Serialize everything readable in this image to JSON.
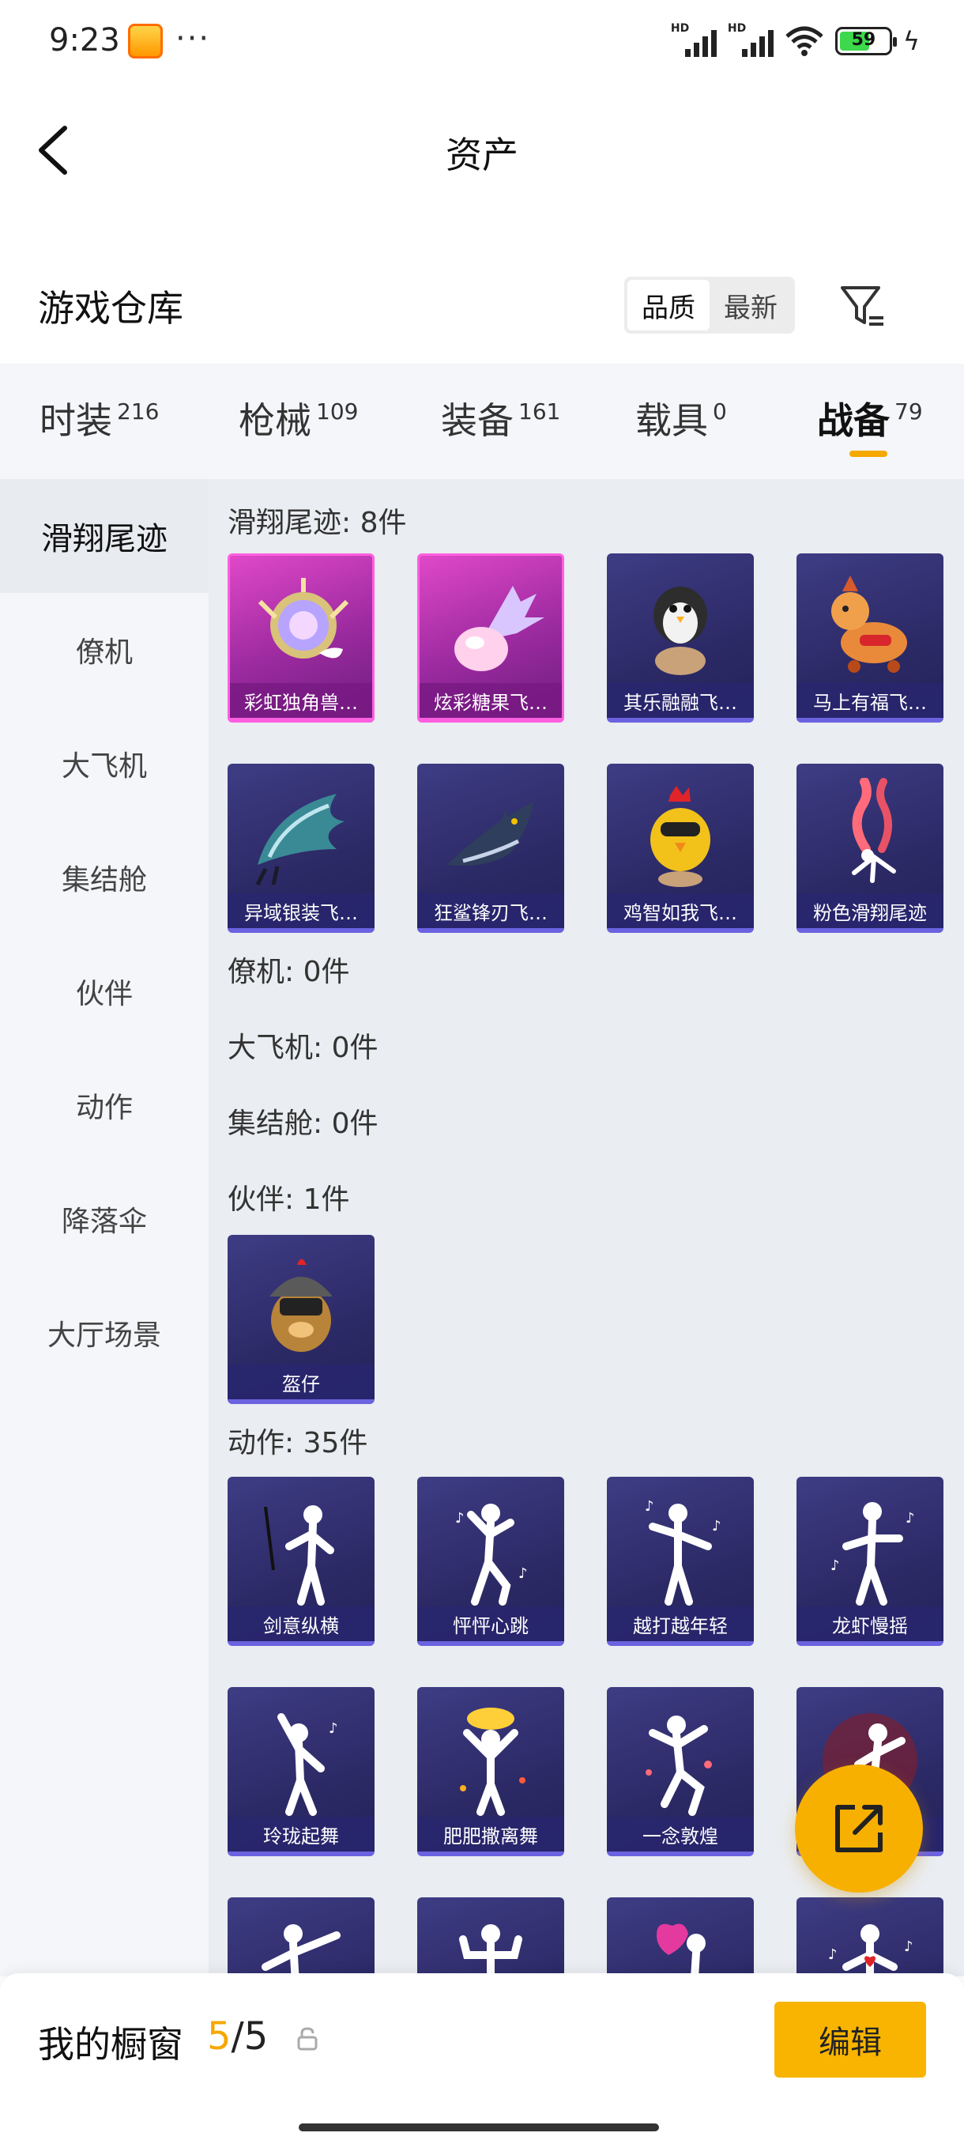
{
  "status_bar": {
    "time": "9:23",
    "dots": "···",
    "signal1_label": "HD",
    "signal2_label": "HD",
    "battery_level": "59"
  },
  "header": {
    "title": "资产"
  },
  "section": {
    "title": "游戏仓库",
    "sort_options": [
      "品质",
      "最新"
    ],
    "sort_selected": "品质"
  },
  "tabs": [
    {
      "label": "时装",
      "count": "216"
    },
    {
      "label": "枪械",
      "count": "109"
    },
    {
      "label": "装备",
      "count": "161"
    },
    {
      "label": "载具",
      "count": "0"
    },
    {
      "label": "战备",
      "count": "79"
    }
  ],
  "active_tab": "战备",
  "sidenav": [
    {
      "label": "滑翔尾迹"
    },
    {
      "label": "僚机"
    },
    {
      "label": "大飞机"
    },
    {
      "label": "集结舱"
    },
    {
      "label": "伙伴"
    },
    {
      "label": "动作"
    },
    {
      "label": "降落伞"
    },
    {
      "label": "大厅场景"
    }
  ],
  "groups": {
    "glide": {
      "label": "滑翔尾迹: 8件",
      "items": [
        {
          "name": "彩虹独角兽…",
          "rarity": "pink",
          "icon": "unicorn-mirror-icon"
        },
        {
          "name": "炫彩糖果飞…",
          "rarity": "pink",
          "icon": "candy-wing-icon"
        },
        {
          "name": "其乐融融飞…",
          "rarity": "purple",
          "icon": "penguin-icon"
        },
        {
          "name": "马上有福飞…",
          "rarity": "purple",
          "icon": "horse-toy-icon"
        },
        {
          "name": "异域银装飞…",
          "rarity": "purple",
          "icon": "silver-wing-icon"
        },
        {
          "name": "狂鲨锋刃飞…",
          "rarity": "purple",
          "icon": "shark-icon"
        },
        {
          "name": "鸡智如我飞…",
          "rarity": "purple",
          "icon": "chicken-icon"
        },
        {
          "name": "粉色滑翔尾迹",
          "rarity": "purple",
          "icon": "pink-smoke-icon"
        }
      ]
    },
    "wingman": {
      "label": "僚机: 0件"
    },
    "bigplane": {
      "label": "大飞机: 0件"
    },
    "pod": {
      "label": "集结舱: 0件"
    },
    "partner": {
      "label": "伙伴: 1件",
      "items": [
        {
          "name": "盔仔",
          "rarity": "purple",
          "icon": "helmet-bird-icon"
        }
      ]
    },
    "emote": {
      "label": "动作: 35件",
      "items": [
        {
          "name": "剑意纵横",
          "icon": "sword-dance-icon"
        },
        {
          "name": "怦怦心跳",
          "icon": "heartbeat-dance-icon"
        },
        {
          "name": "越打越年轻",
          "icon": "young-dance-icon"
        },
        {
          "name": "龙虾慢摇",
          "icon": "lobster-dance-icon"
        },
        {
          "name": "玲珑起舞",
          "icon": "graceful-dance-icon"
        },
        {
          "name": "肥肥撒离舞",
          "icon": "firework-dance-icon"
        },
        {
          "name": "一念敦煌",
          "icon": "dunhuang-dance-icon"
        },
        {
          "name": "",
          "icon": "party-dance-icon"
        },
        {
          "name": "",
          "icon": "pose-dance-icon"
        },
        {
          "name": "",
          "icon": "muscle-dance-icon"
        },
        {
          "name": "",
          "icon": "heart-dance-icon"
        },
        {
          "name": "",
          "icon": "heart-note-dance-icon"
        }
      ]
    }
  },
  "bottom_bar": {
    "label": "我的橱窗",
    "current": "5",
    "total": "/5",
    "edit_label": "编辑"
  },
  "colors": {
    "accent": "#f5a800",
    "card_purple": "#2c2a66",
    "card_pink": "#c23cbc",
    "card_border": "#6b62e0"
  }
}
